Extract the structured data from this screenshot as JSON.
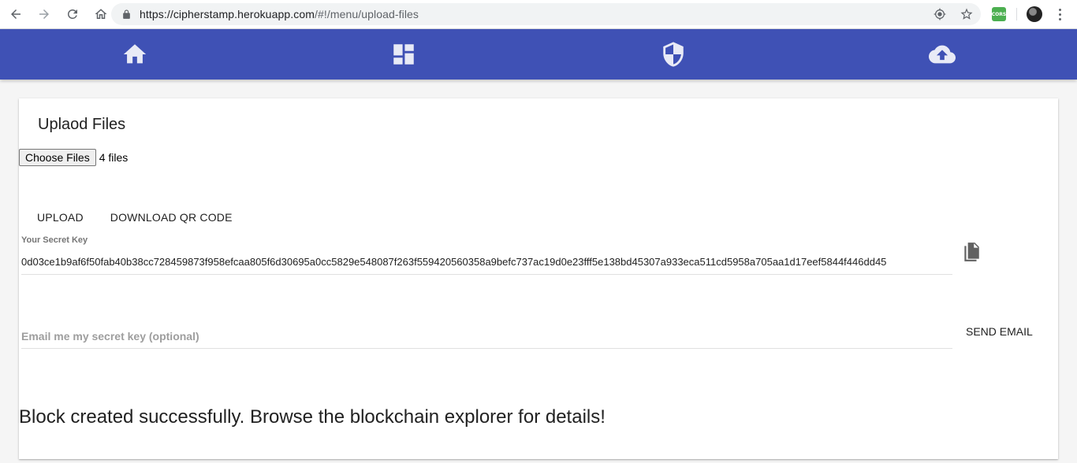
{
  "browser": {
    "url_host": "https://cipherstamp.herokuapp.com",
    "url_path": "/#!/menu/upload-files",
    "extension_label": "CORS",
    "icons": [
      "back-icon",
      "forward-icon",
      "reload-icon",
      "home-icon",
      "lock-icon",
      "location-icon",
      "star-icon",
      "cors-extension-icon",
      "profile-avatar",
      "menu-icon"
    ]
  },
  "toolbar": {
    "color": "#3f51b5",
    "tabs": [
      {
        "icon": "home-icon"
      },
      {
        "icon": "dashboard-icon"
      },
      {
        "icon": "shield-icon"
      },
      {
        "icon": "cloud-upload-icon"
      }
    ]
  },
  "card": {
    "title": "Uplaod Files",
    "choose_files_label": "Choose Files",
    "file_count": "4 files",
    "upload_label": "UPLOAD",
    "download_qr_label": "DOWNLOAD QR CODE",
    "secret_key_label": "Your Secret Key",
    "secret_key_value": "0d03ce1b9af6f50fab40b38cc728459873f958efcaa805f6d30695a0cc5829e548087f263f559420560358a9befc737ac19d0e23fff5e138bd45307a933eca511cd5958a705aa1d17eef5844f446dd45",
    "email_placeholder": "Email me my secret key (optional)",
    "send_email_label": "SEND EMAIL",
    "success_message": "Block created successfully. Browse the blockchain explorer for details!"
  }
}
